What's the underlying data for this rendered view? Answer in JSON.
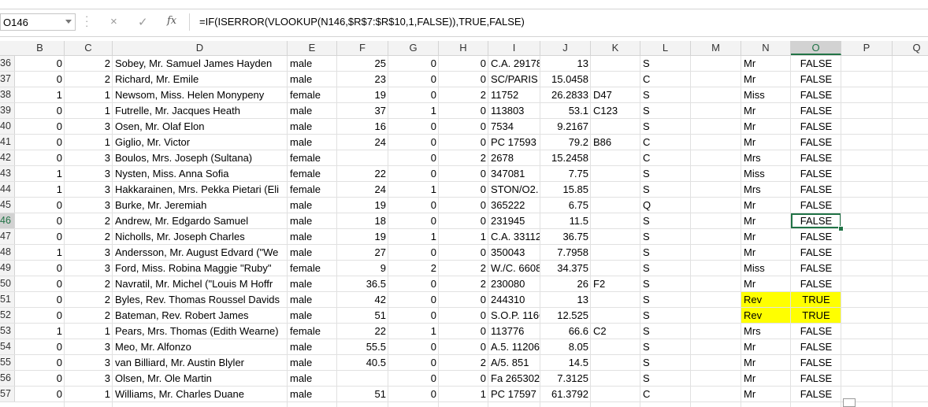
{
  "name_box": {
    "value": "O146"
  },
  "formula_bar": {
    "cancel_glyph": "×",
    "enter_glyph": "✓",
    "fx_label": "fx",
    "formula": "=IF(ISERROR(VLOOKUP(N146,$R$7:$R$10,1,FALSE)),TRUE,FALSE)"
  },
  "columns": [
    "B",
    "C",
    "D",
    "E",
    "F",
    "G",
    "H",
    "I",
    "J",
    "K",
    "L",
    "M",
    "N",
    "O",
    "P",
    "Q"
  ],
  "active_column": "O",
  "active_row": "46",
  "rows": [
    {
      "rh": "36",
      "B": "0",
      "C": "2",
      "D": "Sobey, Mr. Samuel James Hayden",
      "E": "male",
      "F": "25",
      "G": "0",
      "H": "0",
      "I": "C.A. 29178",
      "J": "13",
      "K": "",
      "L": "S",
      "N": "Mr",
      "O": "FALSE"
    },
    {
      "rh": "37",
      "B": "0",
      "C": "2",
      "D": "Richard, Mr. Emile",
      "E": "male",
      "F": "23",
      "G": "0",
      "H": "0",
      "I": "SC/PARIS",
      "J": "15.0458",
      "K": "",
      "L": "C",
      "N": "Mr",
      "O": "FALSE"
    },
    {
      "rh": "38",
      "B": "1",
      "C": "1",
      "D": "Newsom, Miss. Helen Monypeny",
      "E": "female",
      "F": "19",
      "G": "0",
      "H": "2",
      "I": "11752",
      "J": "26.2833",
      "K": "D47",
      "L": "S",
      "N": "Miss",
      "O": "FALSE"
    },
    {
      "rh": "39",
      "B": "0",
      "C": "1",
      "D": "Futrelle, Mr. Jacques Heath",
      "E": "male",
      "F": "37",
      "G": "1",
      "H": "0",
      "I": "113803",
      "J": "53.1",
      "K": "C123",
      "L": "S",
      "N": "Mr",
      "O": "FALSE"
    },
    {
      "rh": "40",
      "B": "0",
      "C": "3",
      "D": "Osen, Mr. Olaf Elon",
      "E": "male",
      "F": "16",
      "G": "0",
      "H": "0",
      "I": "7534",
      "J": "9.2167",
      "K": "",
      "L": "S",
      "N": "Mr",
      "O": "FALSE"
    },
    {
      "rh": "41",
      "B": "0",
      "C": "1",
      "D": "Giglio, Mr. Victor",
      "E": "male",
      "F": "24",
      "G": "0",
      "H": "0",
      "I": "PC 17593",
      "J": "79.2",
      "K": "B86",
      "L": "C",
      "N": "Mr",
      "O": "FALSE"
    },
    {
      "rh": "42",
      "B": "0",
      "C": "3",
      "D": "Boulos, Mrs. Joseph (Sultana)",
      "E": "female",
      "F": "",
      "G": "0",
      "H": "2",
      "I": "2678",
      "J": "15.2458",
      "K": "",
      "L": "C",
      "N": "Mrs",
      "O": "FALSE"
    },
    {
      "rh": "43",
      "B": "1",
      "C": "3",
      "D": "Nysten, Miss. Anna Sofia",
      "E": "female",
      "F": "22",
      "G": "0",
      "H": "0",
      "I": "347081",
      "J": "7.75",
      "K": "",
      "L": "S",
      "N": "Miss",
      "O": "FALSE"
    },
    {
      "rh": "44",
      "B": "1",
      "C": "3",
      "D": "Hakkarainen, Mrs. Pekka Pietari (Eli",
      "E": "female",
      "F": "24",
      "G": "1",
      "H": "0",
      "I": "STON/O2.",
      "J": "15.85",
      "K": "",
      "L": "S",
      "N": "Mrs",
      "O": "FALSE"
    },
    {
      "rh": "45",
      "B": "0",
      "C": "3",
      "D": "Burke, Mr. Jeremiah",
      "E": "male",
      "F": "19",
      "G": "0",
      "H": "0",
      "I": "365222",
      "J": "6.75",
      "K": "",
      "L": "Q",
      "N": "Mr",
      "O": "FALSE"
    },
    {
      "rh": "46",
      "B": "0",
      "C": "2",
      "D": "Andrew, Mr. Edgardo Samuel",
      "E": "male",
      "F": "18",
      "G": "0",
      "H": "0",
      "I": "231945",
      "J": "11.5",
      "K": "",
      "L": "S",
      "N": "Mr",
      "O": "FALSE"
    },
    {
      "rh": "47",
      "B": "0",
      "C": "2",
      "D": "Nicholls, Mr. Joseph Charles",
      "E": "male",
      "F": "19",
      "G": "1",
      "H": "1",
      "I": "C.A. 33112",
      "J": "36.75",
      "K": "",
      "L": "S",
      "N": "Mr",
      "O": "FALSE"
    },
    {
      "rh": "48",
      "B": "1",
      "C": "3",
      "D": "Andersson, Mr. August Edvard (\"We",
      "E": "male",
      "F": "27",
      "G": "0",
      "H": "0",
      "I": "350043",
      "J": "7.7958",
      "K": "",
      "L": "S",
      "N": "Mr",
      "O": "FALSE"
    },
    {
      "rh": "49",
      "B": "0",
      "C": "3",
      "D": "Ford, Miss. Robina Maggie \"Ruby\"",
      "E": "female",
      "F": "9",
      "G": "2",
      "H": "2",
      "I": "W./C. 6608",
      "J": "34.375",
      "K": "",
      "L": "S",
      "N": "Miss",
      "O": "FALSE"
    },
    {
      "rh": "50",
      "B": "0",
      "C": "2",
      "D": "Navratil, Mr. Michel (\"Louis M Hoffr",
      "E": "male",
      "F": "36.5",
      "G": "0",
      "H": "2",
      "I": "230080",
      "J": "26",
      "K": "F2",
      "L": "S",
      "N": "Mr",
      "O": "FALSE"
    },
    {
      "rh": "51",
      "B": "0",
      "C": "2",
      "D": "Byles, Rev. Thomas Roussel Davids",
      "E": "male",
      "F": "42",
      "G": "0",
      "H": "0",
      "I": "244310",
      "J": "13",
      "K": "",
      "L": "S",
      "N": "Rev",
      "O": "TRUE",
      "hl": true
    },
    {
      "rh": "52",
      "B": "0",
      "C": "2",
      "D": "Bateman, Rev. Robert James",
      "E": "male",
      "F": "51",
      "G": "0",
      "H": "0",
      "I": "S.O.P. 1166",
      "J": "12.525",
      "K": "",
      "L": "S",
      "N": "Rev",
      "O": "TRUE",
      "hl": true
    },
    {
      "rh": "53",
      "B": "1",
      "C": "1",
      "D": "Pears, Mrs. Thomas (Edith Wearne)",
      "E": "female",
      "F": "22",
      "G": "1",
      "H": "0",
      "I": "113776",
      "J": "66.6",
      "K": "C2",
      "L": "S",
      "N": "Mrs",
      "O": "FALSE"
    },
    {
      "rh": "54",
      "B": "0",
      "C": "3",
      "D": "Meo, Mr. Alfonzo",
      "E": "male",
      "F": "55.5",
      "G": "0",
      "H": "0",
      "I": "A.5. 11206",
      "J": "8.05",
      "K": "",
      "L": "S",
      "N": "Mr",
      "O": "FALSE"
    },
    {
      "rh": "55",
      "B": "0",
      "C": "3",
      "D": "van Billiard, Mr. Austin Blyler",
      "E": "male",
      "F": "40.5",
      "G": "0",
      "H": "2",
      "I": "A/5. 851",
      "J": "14.5",
      "K": "",
      "L": "S",
      "N": "Mr",
      "O": "FALSE"
    },
    {
      "rh": "56",
      "B": "0",
      "C": "3",
      "D": "Olsen, Mr. Ole Martin",
      "E": "male",
      "F": "",
      "G": "0",
      "H": "0",
      "I": "Fa 265302",
      "J": "7.3125",
      "K": "",
      "L": "S",
      "N": "Mr",
      "O": "FALSE"
    },
    {
      "rh": "57",
      "B": "0",
      "C": "1",
      "D": "Williams, Mr. Charles Duane",
      "E": "male",
      "F": "51",
      "G": "0",
      "H": "1",
      "I": "PC 17597",
      "J": "61.3792",
      "K": "",
      "L": "C",
      "N": "Mr",
      "O": "FALSE"
    }
  ],
  "colors": {
    "selection": "#217346",
    "highlight": "#ffff00",
    "header_bg": "#f3f3f3",
    "gridline": "#e1e1e1"
  }
}
